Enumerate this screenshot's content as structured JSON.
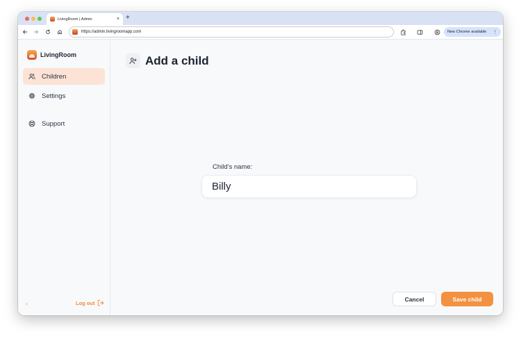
{
  "browser": {
    "tab_title": "LivingRoom | Admin",
    "tab_close": "×",
    "new_tab": "+",
    "url": "https://admin.livingroomapp.com",
    "update_label": "New Chrome available",
    "menu_glyph": "⋮"
  },
  "sidebar": {
    "brand": "LivingRoom",
    "items": [
      {
        "label": "Children",
        "icon": "users-icon",
        "active": true
      },
      {
        "label": "Settings",
        "icon": "gear-icon",
        "active": false
      },
      {
        "label": "Support",
        "icon": "lifebuoy-icon",
        "active": false
      }
    ],
    "collapse_glyph": "‹",
    "logout_label": "Log out"
  },
  "main": {
    "title": "Add a child",
    "title_icon": "add-user-icon",
    "field_label": "Child's name:",
    "field_value": "Billy"
  },
  "actions": {
    "cancel_label": "Cancel",
    "save_label": "Save child"
  },
  "colors": {
    "accent": "#f2913f",
    "active_nav_bg": "#fce3d5",
    "tabstrip_bg": "#d8e2f4"
  }
}
